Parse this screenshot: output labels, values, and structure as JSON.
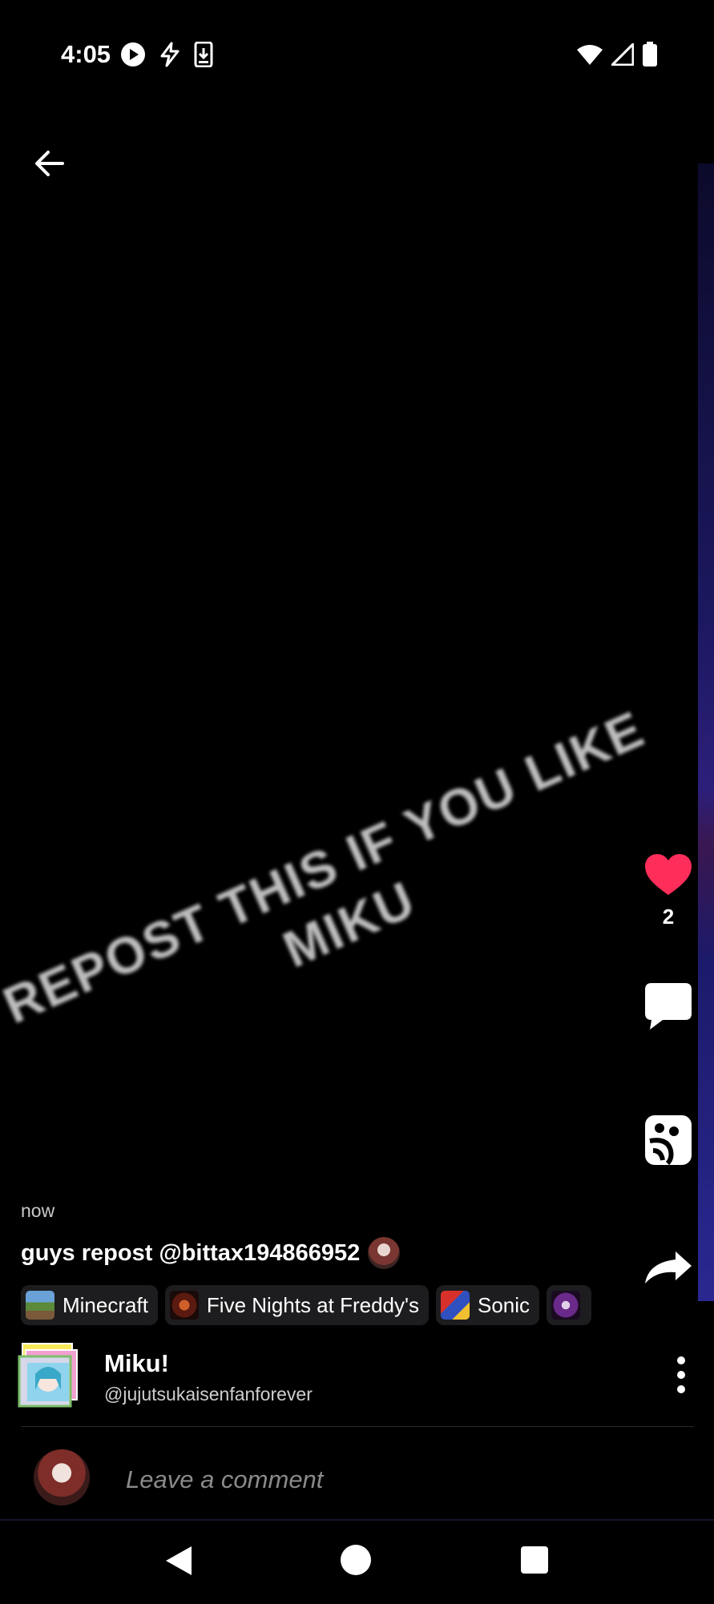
{
  "status_bar": {
    "time": "4:05",
    "left_icons": [
      "play-icon",
      "flash-icon",
      "download-icon"
    ],
    "right_icons": [
      "wifi-icon",
      "signal-icon",
      "battery-icon"
    ]
  },
  "video": {
    "overlay_text_line1": "REPOST THIS IF YOU LIKE",
    "overlay_text_line2": "MIKU"
  },
  "actions": {
    "like_count": "2",
    "like_color": "#ff2d5a"
  },
  "post": {
    "time_ago": "now",
    "caption": "guys repost @bittax194866952",
    "tags": [
      {
        "label": "Minecraft"
      },
      {
        "label": "Five Nights at Freddy's"
      },
      {
        "label": "Sonic"
      },
      {
        "label": ""
      }
    ]
  },
  "community": {
    "name": "Miku!",
    "handle": "@jujutsukaisenfanforever"
  },
  "comment_bar": {
    "placeholder": "Leave a comment"
  }
}
